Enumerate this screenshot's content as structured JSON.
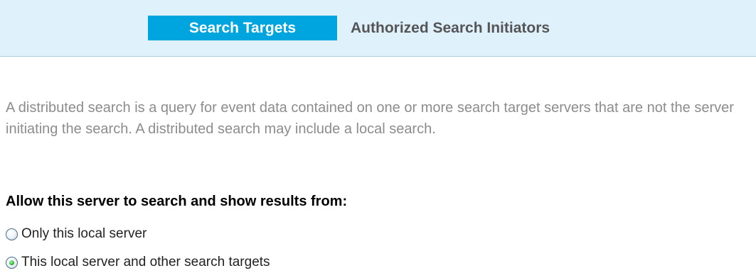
{
  "tabs": {
    "active_label": "Search Targets",
    "inactive_label": "Authorized Search Initiators"
  },
  "description": "A distributed search is a query for event data contained on one or more search target servers that are not the server initiating the search. A distributed search may include a local search.",
  "section": {
    "heading": "Allow this server to search and show results from:"
  },
  "options": [
    {
      "label": "Only this local server",
      "selected": false
    },
    {
      "label": "This local server and other search targets",
      "selected": true
    }
  ],
  "colors": {
    "tab_bar_background": "#dff1fa",
    "active_tab_background": "#00a4df",
    "description_text": "#8c8c8c"
  }
}
